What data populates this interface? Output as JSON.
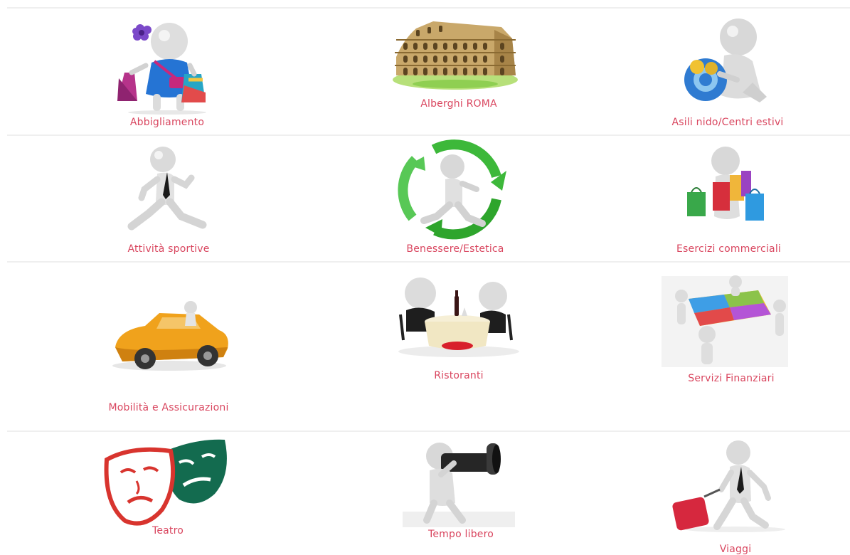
{
  "categories": [
    {
      "label": "Abbigliamento",
      "icon": "shopping-girl-icon"
    },
    {
      "label": "Alberghi ROMA",
      "icon": "colosseum-icon"
    },
    {
      "label": "Asili nido/Centri estivi",
      "icon": "child-toy-icon"
    },
    {
      "label": "Attività sportive",
      "icon": "running-man-icon"
    },
    {
      "label": "Benessere/Estetica",
      "icon": "recycle-runner-icon"
    },
    {
      "label": "Esercizi commerciali",
      "icon": "shopping-bags-icon"
    },
    {
      "label": "Mobilità e Assicurazioni",
      "icon": "car-icon"
    },
    {
      "label": "Ristoranti",
      "icon": "restaurant-table-icon"
    },
    {
      "label": "Servizi Finanziari",
      "icon": "puzzle-team-icon"
    },
    {
      "label": "Teatro",
      "icon": "theatre-masks-icon"
    },
    {
      "label": "Tempo libero",
      "icon": "binoculars-icon"
    },
    {
      "label": "Viaggi",
      "icon": "traveler-suitcase-icon"
    }
  ],
  "colors": {
    "label": "#d9465f",
    "divider": "#efefef"
  }
}
